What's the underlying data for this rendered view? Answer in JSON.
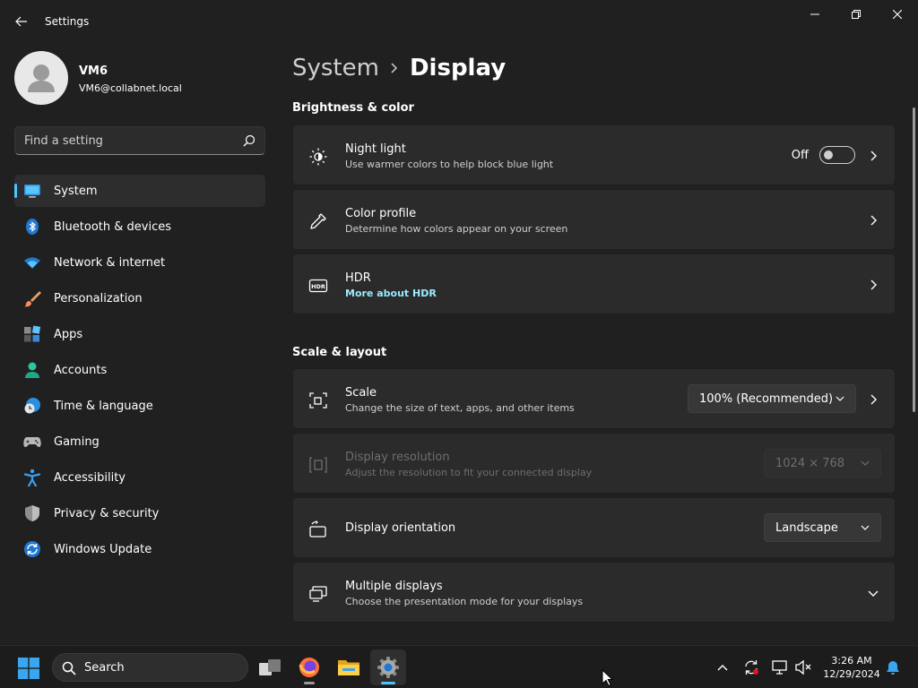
{
  "window": {
    "title": "Settings"
  },
  "profile": {
    "name": "VM6",
    "email": "VM6@collabnet.local"
  },
  "search": {
    "placeholder": "Find a setting"
  },
  "sidebar": {
    "items": [
      {
        "label": "System",
        "icon": "monitor-icon",
        "active": true
      },
      {
        "label": "Bluetooth & devices",
        "icon": "bluetooth-icon"
      },
      {
        "label": "Network & internet",
        "icon": "wifi-icon"
      },
      {
        "label": "Personalization",
        "icon": "brush-icon"
      },
      {
        "label": "Apps",
        "icon": "apps-icon"
      },
      {
        "label": "Accounts",
        "icon": "person-icon"
      },
      {
        "label": "Time & language",
        "icon": "clock-globe-icon"
      },
      {
        "label": "Gaming",
        "icon": "gamepad-icon"
      },
      {
        "label": "Accessibility",
        "icon": "accessibility-icon"
      },
      {
        "label": "Privacy & security",
        "icon": "shield-icon"
      },
      {
        "label": "Windows Update",
        "icon": "update-icon"
      }
    ]
  },
  "breadcrumb": {
    "parent": "System",
    "current": "Display"
  },
  "sections": {
    "brightness": "Brightness & color",
    "scale_layout": "Scale & layout"
  },
  "cards": {
    "night_light": {
      "title": "Night light",
      "subtitle": "Use warmer colors to help block blue light",
      "toggle_label": "Off",
      "toggle_on": false
    },
    "color_profile": {
      "title": "Color profile",
      "subtitle": "Determine how colors appear on your screen"
    },
    "hdr": {
      "title": "HDR",
      "link": "More about HDR"
    },
    "scale": {
      "title": "Scale",
      "subtitle": "Change the size of text, apps, and other items",
      "value": "100% (Recommended)"
    },
    "resolution": {
      "title": "Display resolution",
      "subtitle": "Adjust the resolution to fit your connected display",
      "value": "1024 × 768",
      "disabled": true
    },
    "orientation": {
      "title": "Display orientation",
      "value": "Landscape"
    },
    "multiple": {
      "title": "Multiple displays",
      "subtitle": "Choose the presentation mode for your displays"
    }
  },
  "taskbar": {
    "search_label": "Search",
    "time": "3:26 AM",
    "date": "12/29/2024"
  },
  "colors": {
    "accent": "#4cc2ff",
    "link": "#99ebff",
    "background": "#202020",
    "card": "#2b2b2b"
  }
}
